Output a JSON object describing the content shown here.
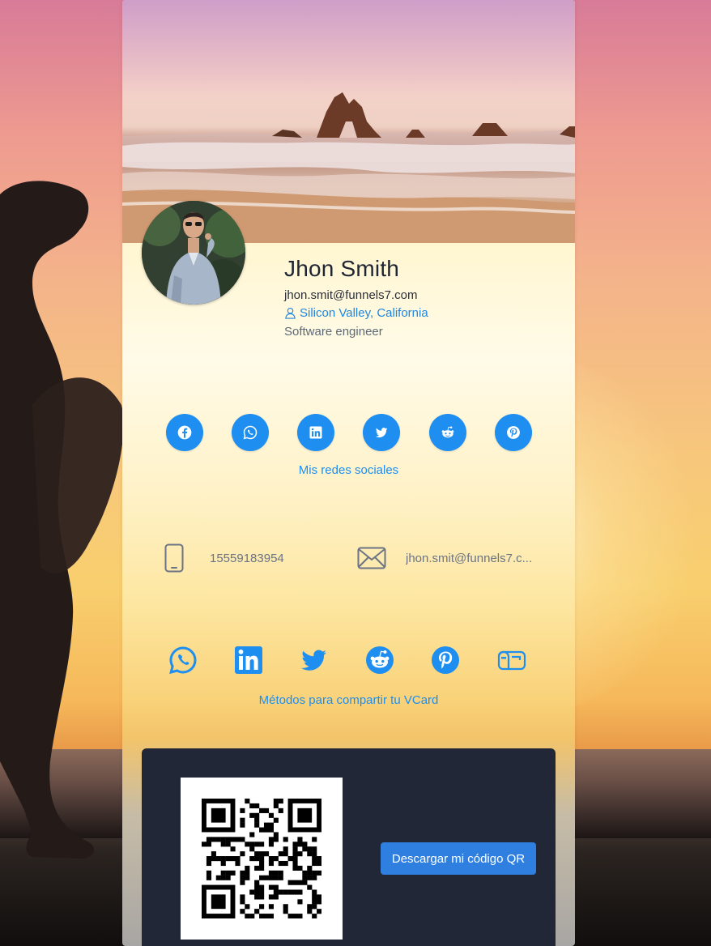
{
  "profile": {
    "name": "Jhon Smith",
    "email": "jhon.smit@funnels7.com",
    "location": "Silicon Valley, California",
    "job_title": "Software engineer"
  },
  "social": {
    "caption": "Mis redes sociales",
    "items": [
      {
        "name": "facebook",
        "icon": "facebook-icon"
      },
      {
        "name": "whatsapp",
        "icon": "whatsapp-icon"
      },
      {
        "name": "linkedin",
        "icon": "linkedin-icon"
      },
      {
        "name": "twitter",
        "icon": "twitter-icon"
      },
      {
        "name": "reddit",
        "icon": "reddit-icon"
      },
      {
        "name": "pinterest",
        "icon": "pinterest-icon"
      }
    ]
  },
  "contact": {
    "phone": "15559183954",
    "email": "jhon.smit@funnels7.c..."
  },
  "share": {
    "caption": "Métodos para compartir tu VCard",
    "items": [
      {
        "name": "whatsapp",
        "icon": "whatsapp-icon"
      },
      {
        "name": "linkedin",
        "icon": "linkedin-icon"
      },
      {
        "name": "twitter",
        "icon": "twitter-icon"
      },
      {
        "name": "reddit",
        "icon": "reddit-icon"
      },
      {
        "name": "pinterest",
        "icon": "pinterest-icon"
      },
      {
        "name": "mailbox",
        "icon": "mailbox-icon"
      }
    ]
  },
  "qr": {
    "download_label": "Descargar mi código QR"
  },
  "colors": {
    "accent": "#1e8ef0",
    "qr_panel": "#222737",
    "download_button": "#2f7fe0",
    "name_text": "#1f2533"
  }
}
